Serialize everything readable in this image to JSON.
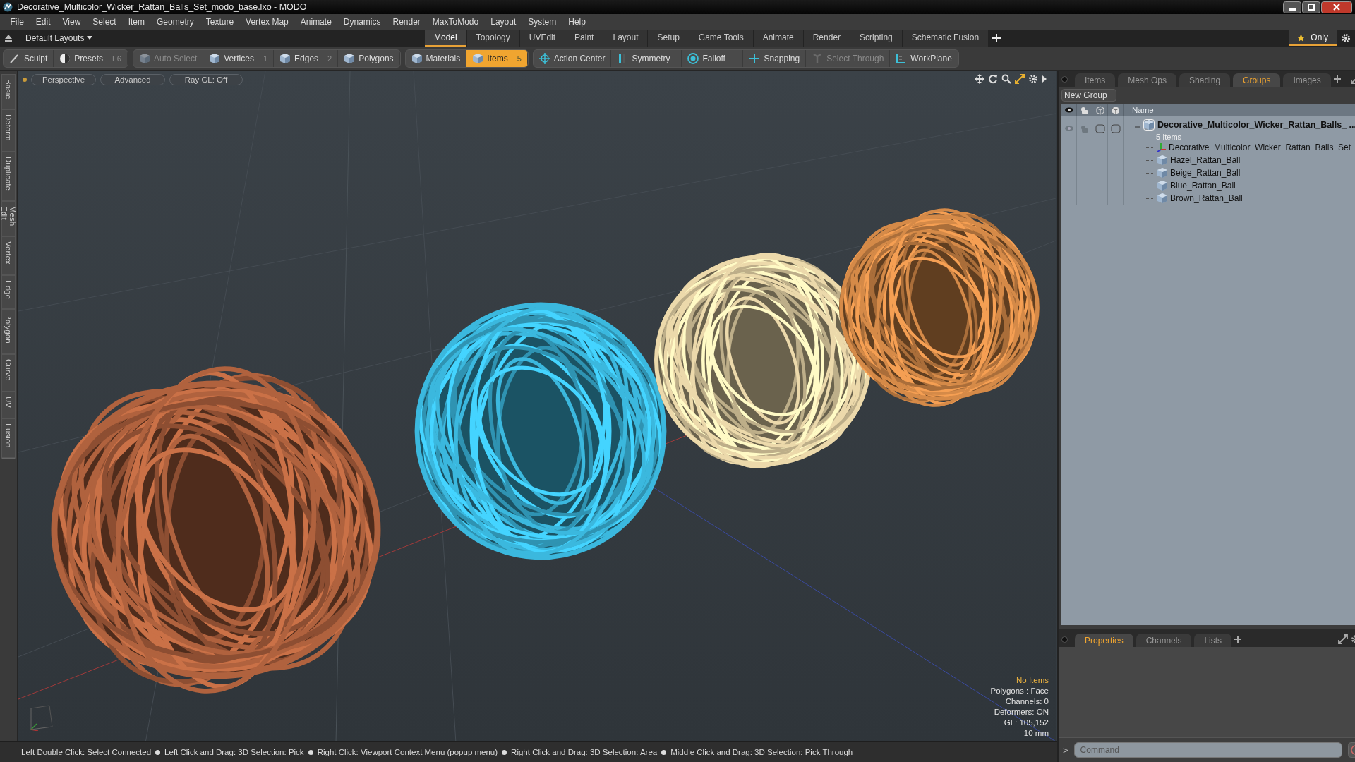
{
  "window": {
    "title": "Decorative_Multicolor_Wicker_Rattan_Balls_Set_modo_base.lxo - MODO"
  },
  "menu": [
    "File",
    "Edit",
    "View",
    "Select",
    "Item",
    "Geometry",
    "Texture",
    "Vertex Map",
    "Animate",
    "Dynamics",
    "Render",
    "MaxToModo",
    "Layout",
    "System",
    "Help"
  ],
  "layout_bar": {
    "layouts": "Default Layouts",
    "tabs": [
      {
        "label": "Model",
        "selected": true
      },
      {
        "label": "Topology",
        "selected": false
      },
      {
        "label": "UVEdit",
        "selected": false
      },
      {
        "label": "Paint",
        "selected": false
      },
      {
        "label": "Layout",
        "selected": false
      },
      {
        "label": "Setup",
        "selected": false
      },
      {
        "label": "Game Tools",
        "selected": false
      },
      {
        "label": "Animate",
        "selected": false
      },
      {
        "label": "Render",
        "selected": false
      },
      {
        "label": "Scripting",
        "selected": false
      },
      {
        "label": "Schematic Fusion",
        "selected": false
      }
    ],
    "only": "Only"
  },
  "toolbar": [
    {
      "items": [
        {
          "label": "Sculpt",
          "selected": false,
          "disabled": false
        },
        {
          "label": "Presets",
          "shortcut": "F6",
          "selected": false,
          "disabled": false
        }
      ]
    },
    {
      "items": [
        {
          "label": "Auto Select",
          "selected": false,
          "disabled": true
        },
        {
          "label": "Vertices",
          "shortcut": "1",
          "selected": false,
          "disabled": false
        },
        {
          "label": "Edges",
          "shortcut": "2",
          "selected": false,
          "disabled": false
        },
        {
          "label": "Polygons",
          "selected": false,
          "disabled": false
        }
      ]
    },
    {
      "items": [
        {
          "label": "Materials",
          "selected": false,
          "disabled": false
        },
        {
          "label": "Items",
          "shortcut": "5",
          "selected": true,
          "disabled": false
        }
      ]
    },
    {
      "items": [
        {
          "label": "Action Center",
          "selected": false,
          "disabled": false
        },
        {
          "label": "Symmetry",
          "selected": false,
          "disabled": false
        },
        {
          "label": "Falloff",
          "selected": false,
          "disabled": false
        },
        {
          "label": "Snapping",
          "selected": false,
          "disabled": false
        },
        {
          "label": "Select Through",
          "selected": false,
          "disabled": true
        },
        {
          "label": "WorkPlane",
          "selected": false,
          "disabled": false
        }
      ]
    }
  ],
  "side_tabs": [
    "Basic",
    "Deform",
    "Duplicate",
    "Mesh Edit",
    "Vertex",
    "Edge",
    "Polygon",
    "Curve",
    "UV",
    "Fusion"
  ],
  "viewport": {
    "buttons": [
      "Perspective",
      "Advanced",
      "Ray GL: Off"
    ],
    "balls": [
      {
        "color": "#b0623e"
      },
      {
        "color": "#3bb8de"
      },
      {
        "color": "#ecd9ab"
      },
      {
        "color": "#d58a48"
      }
    ],
    "info": [
      {
        "text": "No Items",
        "kind": "highlight"
      },
      {
        "text": "Polygons : Face",
        "kind": "plain"
      },
      {
        "text": "Channels: 0",
        "kind": "plain"
      },
      {
        "text": "Deformers: ON",
        "kind": "plain"
      },
      {
        "text": "GL: 105,152",
        "kind": "plain"
      },
      {
        "text": "10 mm",
        "kind": "plain"
      }
    ]
  },
  "items_panel": {
    "tabs": [
      {
        "label": "Items",
        "selected": false
      },
      {
        "label": "Mesh Ops",
        "selected": false
      },
      {
        "label": "Shading",
        "selected": false
      },
      {
        "label": "Groups",
        "selected": true
      },
      {
        "label": "Images",
        "selected": false
      }
    ],
    "new_group": "New Group",
    "name_column": "Name",
    "tree": [
      {
        "name": "Decorative_Multicolor_Wicker_Rattan_Balls_ ...",
        "count": "5 Items",
        "expanded": true,
        "children": [
          {
            "name": "Decorative_Multicolor_Wicker_Rattan_Balls_Set",
            "kind": "locator"
          },
          {
            "name": "Hazel_Rattan_Ball",
            "kind": "mesh"
          },
          {
            "name": "Beige_Rattan_Ball",
            "kind": "mesh"
          },
          {
            "name": "Blue_Rattan_Ball",
            "kind": "mesh"
          },
          {
            "name": "Brown_Rattan_Ball",
            "kind": "mesh"
          }
        ]
      }
    ]
  },
  "properties_panel": {
    "tabs": [
      {
        "label": "Properties",
        "selected": true
      },
      {
        "label": "Channels",
        "selected": false
      },
      {
        "label": "Lists",
        "selected": false
      }
    ]
  },
  "command": {
    "prompt": ">",
    "placeholder": "Command"
  },
  "status_bar": [
    "Left Double Click: Select Connected",
    "Left Click and Drag: 3D Selection: Pick",
    "Right Click: Viewport Context Menu (popup menu)",
    "Right Click and Drag: 3D Selection: Area",
    "Middle Click and Drag: 3D Selection: Pick Through"
  ]
}
